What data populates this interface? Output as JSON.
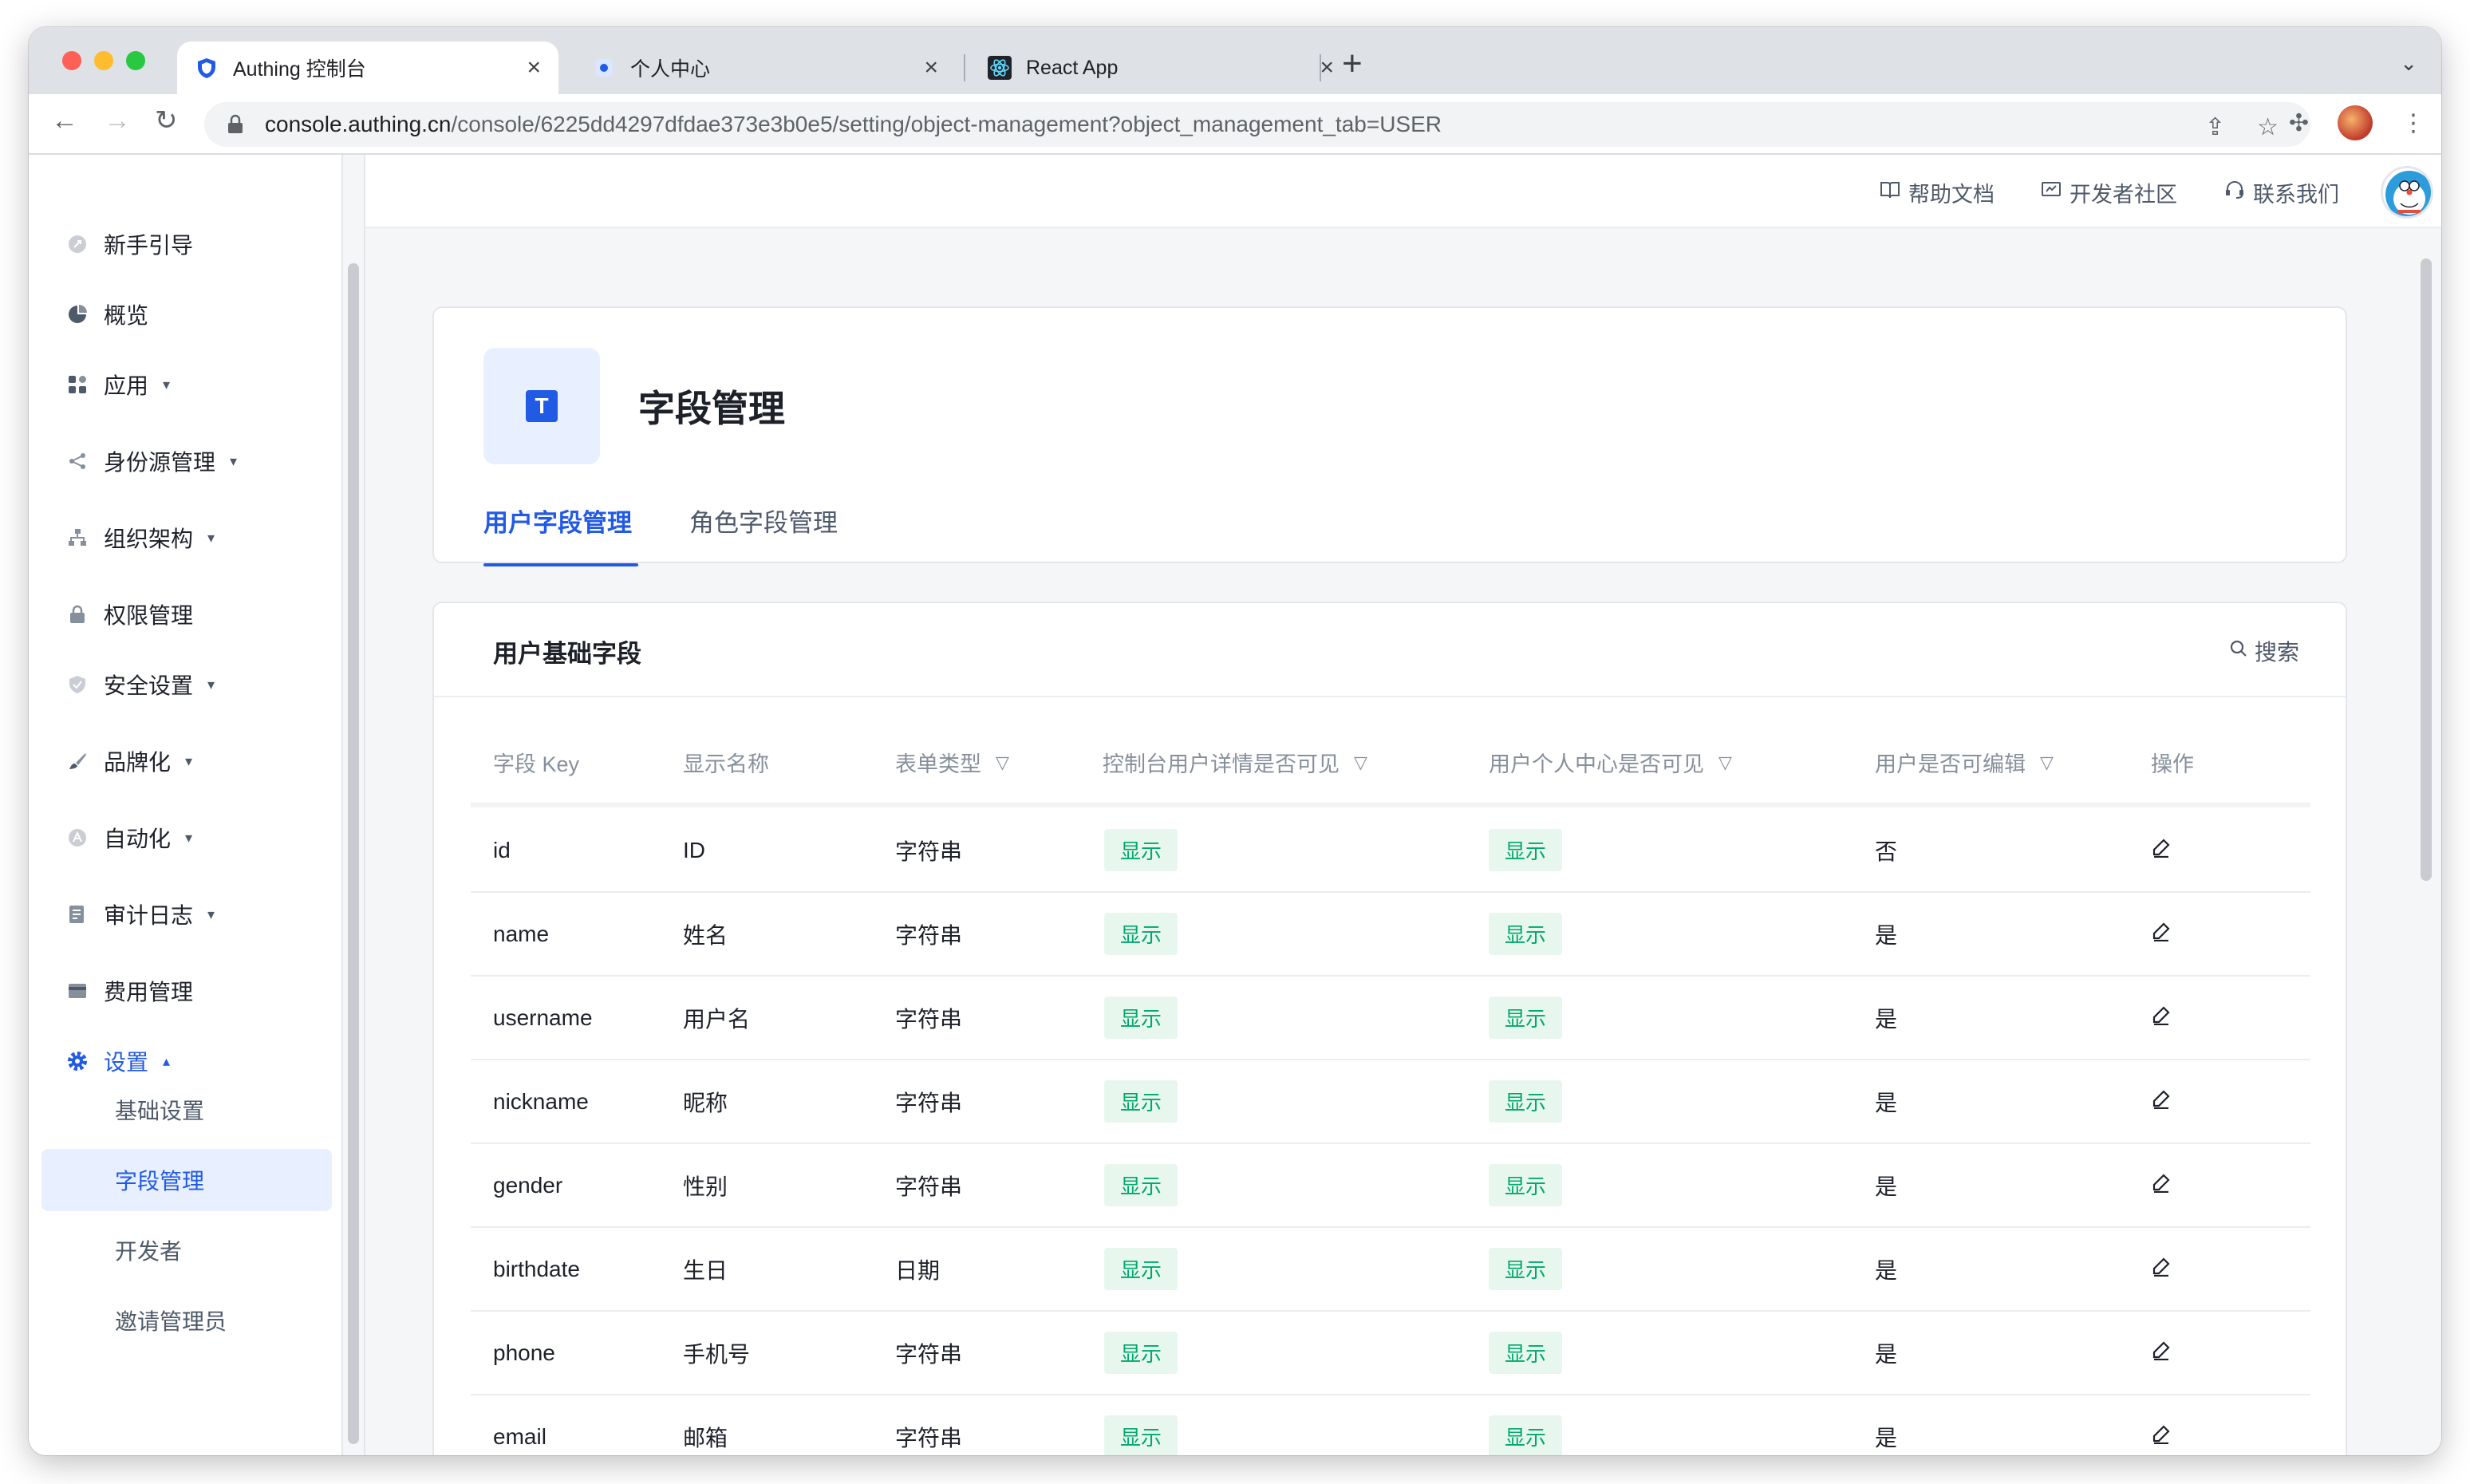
{
  "browser": {
    "tabs": [
      {
        "title": "Authing 控制台",
        "favicon": "shield-icon",
        "active": true
      },
      {
        "title": "个人中心",
        "favicon": "blue-dot-icon",
        "active": false
      },
      {
        "title": "React App",
        "favicon": "react-icon",
        "active": false
      }
    ],
    "url_host": "console.authing.cn",
    "url_path": "/console/6225dd4297dfdae373e3b0e5/setting/object-management?object_management_tab=USER"
  },
  "sidebar": {
    "items": [
      {
        "label": "新手引导",
        "icon": "rocket-icon",
        "caret": ""
      },
      {
        "label": "概览",
        "icon": "pie-chart-icon",
        "caret": ""
      },
      {
        "label": "应用",
        "icon": "apps-grid-icon",
        "caret": "▾"
      },
      {
        "label": "身份源管理",
        "icon": "share-icon",
        "caret": "▾"
      },
      {
        "label": "组织架构",
        "icon": "org-tree-icon",
        "caret": "▾"
      },
      {
        "label": "权限管理",
        "icon": "lock-icon",
        "caret": ""
      },
      {
        "label": "安全设置",
        "icon": "shield-check-icon",
        "caret": "▾"
      },
      {
        "label": "品牌化",
        "icon": "brush-icon",
        "caret": "▾"
      },
      {
        "label": "自动化",
        "icon": "automation-icon",
        "caret": "▾"
      },
      {
        "label": "审计日志",
        "icon": "log-icon",
        "caret": "▾"
      },
      {
        "label": "费用管理",
        "icon": "billing-icon",
        "caret": ""
      },
      {
        "label": "设置",
        "icon": "gear-icon",
        "caret": "▴"
      }
    ],
    "sub_items": [
      {
        "label": "基础设置"
      },
      {
        "label": "字段管理"
      },
      {
        "label": "开发者"
      },
      {
        "label": "邀请管理员"
      }
    ]
  },
  "topbar": {
    "links": [
      {
        "label": "帮助文档",
        "icon": "book-icon"
      },
      {
        "label": "开发者社区",
        "icon": "community-icon"
      },
      {
        "label": "联系我们",
        "icon": "headset-icon"
      }
    ]
  },
  "page": {
    "icon_letter": "T",
    "title": "字段管理",
    "tabs": [
      {
        "label": "用户字段管理",
        "active": true
      },
      {
        "label": "角色字段管理",
        "active": false
      }
    ]
  },
  "section": {
    "title": "用户基础字段",
    "search_label": "搜索"
  },
  "table": {
    "headers": [
      "字段 Key",
      "显示名称",
      "表单类型",
      "控制台用户详情是否可见",
      "用户个人中心是否可见",
      "用户是否可编辑",
      "操作"
    ],
    "rows": [
      {
        "key": "id",
        "name": "ID",
        "type": "字符串",
        "console_visible": "显示",
        "center_visible": "显示",
        "editable": "否"
      },
      {
        "key": "name",
        "name": "姓名",
        "type": "字符串",
        "console_visible": "显示",
        "center_visible": "显示",
        "editable": "是"
      },
      {
        "key": "username",
        "name": "用户名",
        "type": "字符串",
        "console_visible": "显示",
        "center_visible": "显示",
        "editable": "是"
      },
      {
        "key": "nickname",
        "name": "昵称",
        "type": "字符串",
        "console_visible": "显示",
        "center_visible": "显示",
        "editable": "是"
      },
      {
        "key": "gender",
        "name": "性别",
        "type": "字符串",
        "console_visible": "显示",
        "center_visible": "显示",
        "editable": "是"
      },
      {
        "key": "birthdate",
        "name": "生日",
        "type": "日期",
        "console_visible": "显示",
        "center_visible": "显示",
        "editable": "是"
      },
      {
        "key": "phone",
        "name": "手机号",
        "type": "字符串",
        "console_visible": "显示",
        "center_visible": "显示",
        "editable": "是"
      },
      {
        "key": "email",
        "name": "邮箱",
        "type": "字符串",
        "console_visible": "显示",
        "center_visible": "显示",
        "editable": "是"
      }
    ]
  },
  "colors": {
    "accent": "#215ae5",
    "badge_bg": "#e8f7ee",
    "badge_text": "#00a870"
  }
}
